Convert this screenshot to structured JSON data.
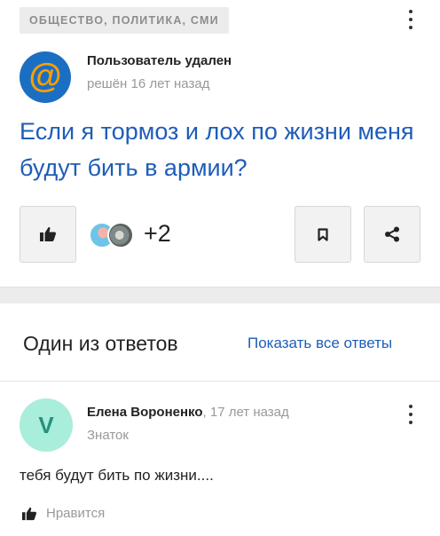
{
  "question": {
    "category": "ОБЩЕСТВО, ПОЛИТИКА, СМИ",
    "author": "Пользователь удален",
    "meta": "решён 16 лет назад",
    "title": "Если я тормоз и лох по жизни меня будут бить в армии?",
    "participants_more": "+2",
    "icons": {
      "menu": "kebab-icon",
      "avatar": "at-sign-icon",
      "like": "thumbs-up-icon",
      "bookmark": "bookmark-icon",
      "share": "share-icon"
    }
  },
  "answers_section": {
    "heading": "Один из ответов",
    "show_all": "Показать все ответы"
  },
  "answer": {
    "avatar_letter": "V",
    "author": "Елена Вороненко",
    "time": ", 17 лет назад",
    "rank": "Знаток",
    "text": "тебя будут бить по жизни....",
    "like_label": "Нравится"
  },
  "colors": {
    "link_blue": "#1e5db8",
    "avatar_q_bg": "#1a6fc2",
    "avatar_q_at": "#ff9e00",
    "avatar_a_bg": "#a9eddb",
    "avatar_a_fg": "#25927d",
    "muted": "#999999",
    "page_bg": "#ececec"
  }
}
